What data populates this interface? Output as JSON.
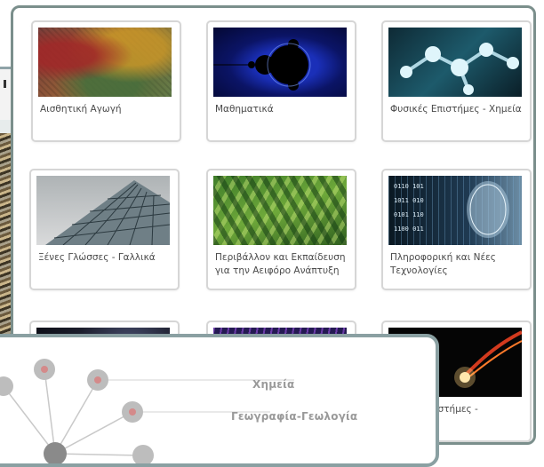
{
  "gallery": {
    "cards": [
      {
        "label": "Αισθητική Αγωγή",
        "thumb": "painted-texture"
      },
      {
        "label": "Μαθηματικά",
        "thumb": "mandelbrot-fractal"
      },
      {
        "label": "Φυσικές Επιστήμες - Χημεία",
        "thumb": "molecule-model"
      },
      {
        "label": "Ξένες Γλώσσες - Γαλλικά",
        "thumb": "glass-pyramid"
      },
      {
        "label": "Περιβάλλον και Εκπαίδευση για την Αειφόρο Ανάπτυξη",
        "thumb": "green-leaves"
      },
      {
        "label": "Πληροφορική και Νέες Τεχνολογίες",
        "thumb": "digital-face"
      },
      {
        "label": "",
        "thumb": "dark-spiral"
      },
      {
        "label": "",
        "thumb": "dna-helix"
      },
      {
        "label": "...ιστήμες -",
        "thumb": "particle-streak"
      }
    ]
  },
  "overlay": {
    "nodes": [
      {
        "label": "Χημεία"
      },
      {
        "label": "Γεωγραφία-Γεωλογία"
      }
    ]
  },
  "colors": {
    "panel_border": "#7b8f8c",
    "overlay_border": "#8aa0a2",
    "card_border": "#d6d6d6",
    "node_color": "#b8b8b8",
    "node_core": "#d48a8a"
  }
}
